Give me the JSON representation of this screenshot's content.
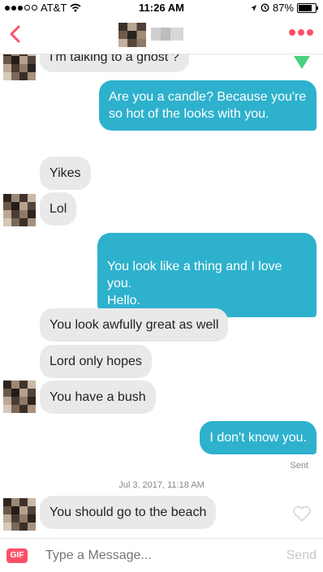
{
  "status_bar": {
    "carrier": "AT&T",
    "time": "11:26 AM",
    "battery": "87%"
  },
  "header": {
    "more_icon": "more-dots-icon",
    "back_icon": "chevron-left-icon"
  },
  "messages": [
    {
      "side": "in",
      "text": "I'm talking to a ghost ?"
    },
    {
      "side": "out",
      "text": "Are you a candle? Because you're so hot of the looks with you."
    },
    {
      "side": "in",
      "text": "Yikes"
    },
    {
      "side": "in",
      "text": "Lol"
    },
    {
      "side": "out",
      "text": "You look like a thing and I love you.\nHello."
    },
    {
      "side": "in",
      "text": "You look awfully great as well"
    },
    {
      "side": "in",
      "text": "Lord only hopes"
    },
    {
      "side": "in",
      "text": "You have a bush"
    },
    {
      "side": "out",
      "text": "I don't know you."
    },
    {
      "side": "in",
      "text": "You should go to the beach"
    }
  ],
  "sent_label": "Sent",
  "date_divider": "Jul 3, 2017, 11:18 AM",
  "composer": {
    "gif_label": "GIF",
    "placeholder": "Type a Message...",
    "send_label": "Send"
  },
  "colors": {
    "accent": "#fd5068",
    "outgoing": "#2eb1cd",
    "incoming": "#e9e9ea",
    "like": "#49d081"
  }
}
